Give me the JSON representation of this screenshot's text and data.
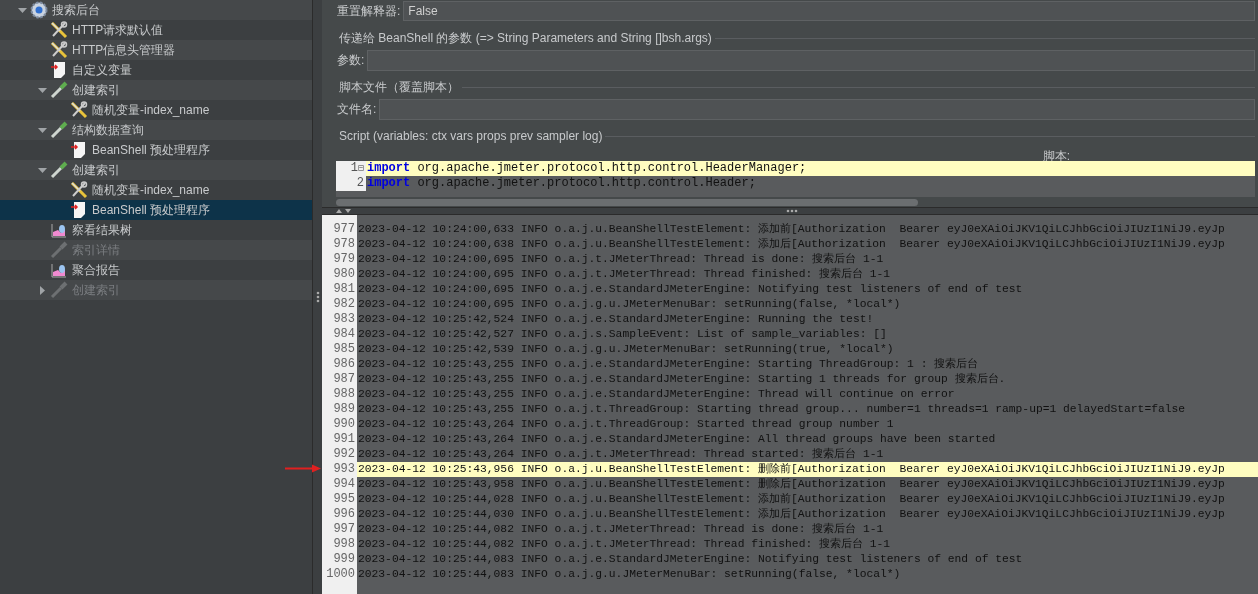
{
  "tree": [
    {
      "label": "搜索后台",
      "kind": "gear",
      "expanded": true,
      "disabled": false,
      "selected": false,
      "children": [
        {
          "label": "HTTP请求默认值",
          "kind": "tools",
          "disabled": false,
          "selected": false
        },
        {
          "label": "HTTP信息头管理器",
          "kind": "tools",
          "disabled": false,
          "selected": false
        },
        {
          "label": "自定义变量",
          "kind": "script",
          "disabled": false,
          "selected": false
        },
        {
          "label": "创建索引",
          "kind": "pipette",
          "expanded": true,
          "disabled": false,
          "selected": false,
          "children": [
            {
              "label": "随机变量-index_name",
              "kind": "tools",
              "disabled": false,
              "selected": false
            }
          ]
        },
        {
          "label": "结构数据查询",
          "kind": "pipette",
          "expanded": true,
          "disabled": false,
          "selected": false,
          "children": [
            {
              "label": "BeanShell 预处理程序",
              "kind": "script",
              "disabled": false,
              "selected": false
            }
          ]
        },
        {
          "label": "创建索引",
          "kind": "pipette",
          "expanded": true,
          "disabled": false,
          "selected": false,
          "children": [
            {
              "label": "随机变量-index_name",
              "kind": "tools",
              "disabled": false,
              "selected": false
            },
            {
              "label": "BeanShell 预处理程序",
              "kind": "script",
              "disabled": false,
              "selected": true
            }
          ]
        },
        {
          "label": "察看结果树",
          "kind": "chart",
          "disabled": false,
          "selected": false
        },
        {
          "label": "索引详情",
          "kind": "pipette",
          "disabled": true,
          "selected": false
        },
        {
          "label": "聚合报告",
          "kind": "chart",
          "disabled": false,
          "selected": false
        },
        {
          "label": "创建索引",
          "kind": "pipette",
          "expanded": false,
          "disabled": true,
          "selected": false
        }
      ]
    }
  ],
  "form": {
    "reset_label": "重置解释器:",
    "reset_value": "False",
    "params_section": "传递给 BeanShell 的参数 (=> String Parameters and String []bsh.args)",
    "params_label": "参数:",
    "file_section": "脚本文件（覆盖脚本）",
    "file_label": "文件名:",
    "script_section": "Script (variables: ctx vars props prev sampler log)",
    "script_label": "脚本:"
  },
  "script_lines": [
    {
      "number": "1",
      "kind": "import",
      "keyword": "import",
      "text": " org.apache.jmeter.protocol.http.control.HeaderManager;",
      "current": true,
      "fold": "⊟"
    },
    {
      "number": "2",
      "kind": "import",
      "keyword": "import",
      "text": " org.apache.jmeter.protocol.http.control.Header;",
      "current": false
    }
  ],
  "log_lines": [
    {
      "number": "977",
      "text": "2023-04-12 10:24:00,633 INFO o.a.j.u.BeanShellTestElement: 添加前[Authorization  Bearer eyJ0eXAiOiJKV1QiLCJhbGciOiJIUzI1NiJ9.eyJp",
      "highlighted": false
    },
    {
      "number": "978",
      "text": "2023-04-12 10:24:00,638 INFO o.a.j.u.BeanShellTestElement: 添加后[Authorization  Bearer eyJ0eXAiOiJKV1QiLCJhbGciOiJIUzI1NiJ9.eyJp",
      "highlighted": false
    },
    {
      "number": "979",
      "text": "2023-04-12 10:24:00,695 INFO o.a.j.t.JMeterThread: Thread is done: 搜索后台 1-1",
      "highlighted": false
    },
    {
      "number": "980",
      "text": "2023-04-12 10:24:00,695 INFO o.a.j.t.JMeterThread: Thread finished: 搜索后台 1-1",
      "highlighted": false
    },
    {
      "number": "981",
      "text": "2023-04-12 10:24:00,695 INFO o.a.j.e.StandardJMeterEngine: Notifying test listeners of end of test",
      "highlighted": false
    },
    {
      "number": "982",
      "text": "2023-04-12 10:24:00,695 INFO o.a.j.g.u.JMeterMenuBar: setRunning(false, *local*)",
      "highlighted": false
    },
    {
      "number": "983",
      "text": "2023-04-12 10:25:42,524 INFO o.a.j.e.StandardJMeterEngine: Running the test!",
      "highlighted": false
    },
    {
      "number": "984",
      "text": "2023-04-12 10:25:42,527 INFO o.a.j.s.SampleEvent: List of sample_variables: []",
      "highlighted": false
    },
    {
      "number": "985",
      "text": "2023-04-12 10:25:42,539 INFO o.a.j.g.u.JMeterMenuBar: setRunning(true, *local*)",
      "highlighted": false
    },
    {
      "number": "986",
      "text": "2023-04-12 10:25:43,255 INFO o.a.j.e.StandardJMeterEngine: Starting ThreadGroup: 1 : 搜索后台",
      "highlighted": false
    },
    {
      "number": "987",
      "text": "2023-04-12 10:25:43,255 INFO o.a.j.e.StandardJMeterEngine: Starting 1 threads for group 搜索后台.",
      "highlighted": false
    },
    {
      "number": "988",
      "text": "2023-04-12 10:25:43,255 INFO o.a.j.e.StandardJMeterEngine: Thread will continue on error",
      "highlighted": false
    },
    {
      "number": "989",
      "text": "2023-04-12 10:25:43,255 INFO o.a.j.t.ThreadGroup: Starting thread group... number=1 threads=1 ramp-up=1 delayedStart=false",
      "highlighted": false
    },
    {
      "number": "990",
      "text": "2023-04-12 10:25:43,264 INFO o.a.j.t.ThreadGroup: Started thread group number 1",
      "highlighted": false
    },
    {
      "number": "991",
      "text": "2023-04-12 10:25:43,264 INFO o.a.j.e.StandardJMeterEngine: All thread groups have been started",
      "highlighted": false
    },
    {
      "number": "992",
      "text": "2023-04-12 10:25:43,264 INFO o.a.j.t.JMeterThread: Thread started: 搜索后台 1-1",
      "highlighted": false
    },
    {
      "number": "993",
      "text": "2023-04-12 10:25:43,956 INFO o.a.j.u.BeanShellTestElement: 删除前[Authorization  Bearer eyJ0eXAiOiJKV1QiLCJhbGciOiJIUzI1NiJ9.eyJp",
      "highlighted": true
    },
    {
      "number": "994",
      "text": "2023-04-12 10:25:43,958 INFO o.a.j.u.BeanShellTestElement: 删除后[Authorization  Bearer eyJ0eXAiOiJKV1QiLCJhbGciOiJIUzI1NiJ9.eyJp",
      "highlighted": false
    },
    {
      "number": "995",
      "text": "2023-04-12 10:25:44,028 INFO o.a.j.u.BeanShellTestElement: 添加前[Authorization  Bearer eyJ0eXAiOiJKV1QiLCJhbGciOiJIUzI1NiJ9.eyJp",
      "highlighted": false
    },
    {
      "number": "996",
      "text": "2023-04-12 10:25:44,030 INFO o.a.j.u.BeanShellTestElement: 添加后[Authorization  Bearer eyJ0eXAiOiJKV1QiLCJhbGciOiJIUzI1NiJ9.eyJp",
      "highlighted": false
    },
    {
      "number": "997",
      "text": "2023-04-12 10:25:44,082 INFO o.a.j.t.JMeterThread: Thread is done: 搜索后台 1-1",
      "highlighted": false
    },
    {
      "number": "998",
      "text": "2023-04-12 10:25:44,082 INFO o.a.j.t.JMeterThread: Thread finished: 搜索后台 1-1",
      "highlighted": false
    },
    {
      "number": "999",
      "text": "2023-04-12 10:25:44,083 INFO o.a.j.e.StandardJMeterEngine: Notifying test listeners of end of test",
      "highlighted": false
    },
    {
      "number": "1000",
      "text": "2023-04-12 10:25:44,083 INFO o.a.j.g.u.JMeterMenuBar: setRunning(false, *local*)",
      "highlighted": false
    }
  ]
}
